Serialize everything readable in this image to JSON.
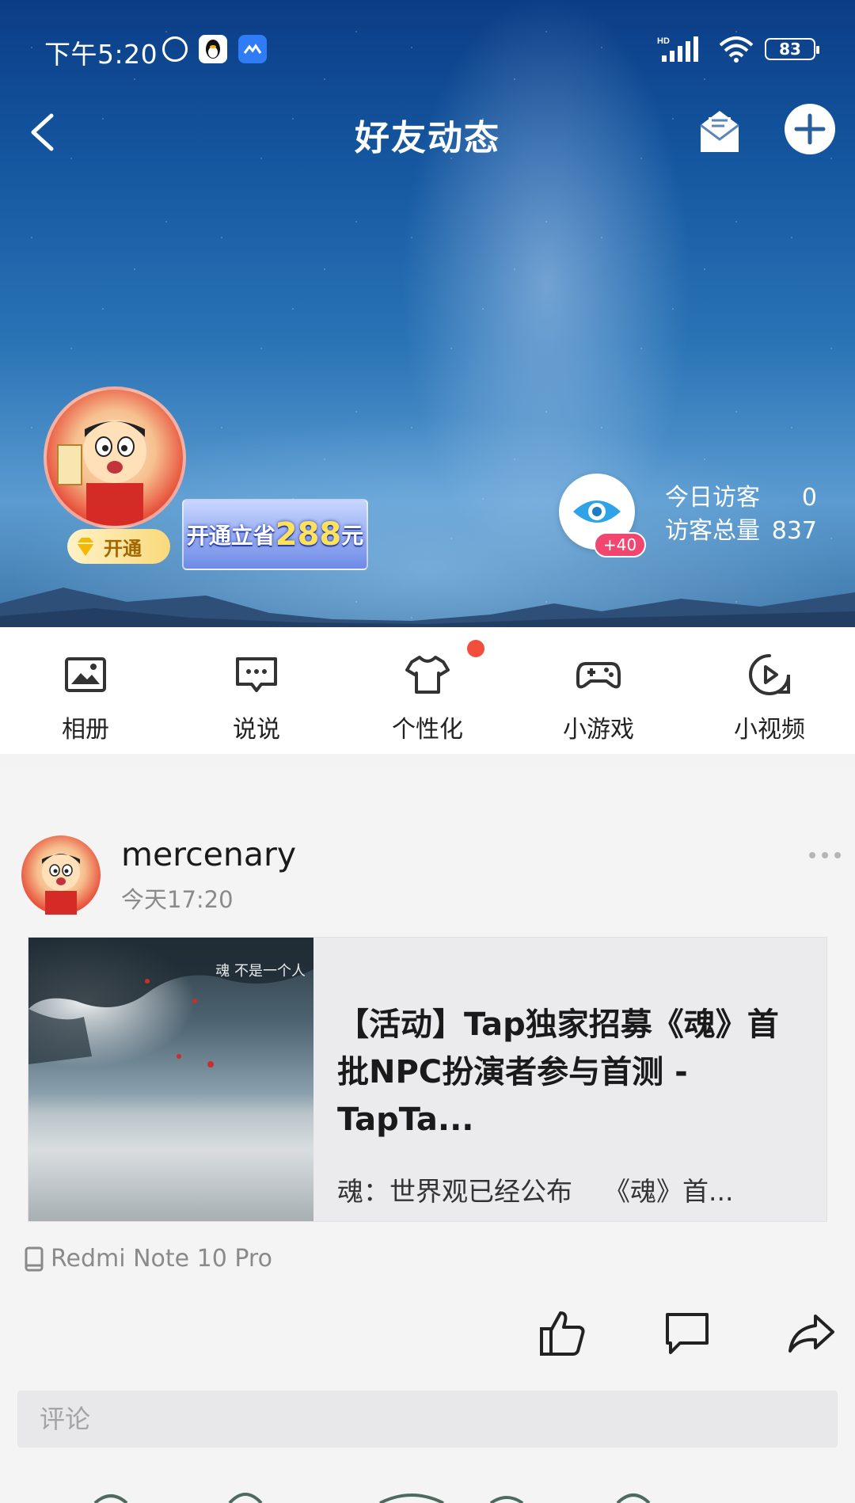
{
  "status_bar": {
    "time": "下午5:20",
    "network": "HD",
    "battery": "83"
  },
  "nav": {
    "title": "好友动态"
  },
  "profile": {
    "vip_label": "开通",
    "promo_text_prefix": "开通立省",
    "promo_amount": "288",
    "promo_suffix": "元",
    "visitor_badge": "+40",
    "today_visitors_label": "今日访客",
    "today_visitors_value": "0",
    "total_visitors_label": "访客总量",
    "total_visitors_value": "837"
  },
  "tabs": [
    {
      "label": "相册",
      "icon": "photo-album-icon"
    },
    {
      "label": "说说",
      "icon": "message-bubble-icon"
    },
    {
      "label": "个性化",
      "icon": "tshirt-icon"
    },
    {
      "label": "小游戏",
      "icon": "gamepad-icon"
    },
    {
      "label": "小视频",
      "icon": "video-play-icon"
    }
  ],
  "post": {
    "author": "mercenary",
    "time": "今天17:20",
    "card": {
      "thumb_caption": "魂 不是一个人",
      "title": "【活动】Tap独家招募《魂》首批NPC扮演者参与首测 - TapTa...",
      "desc_left": "魂：世界观已经公布",
      "desc_right": "《魂》首..."
    },
    "device": "Redmi Note 10 Pro",
    "comment_placeholder": "评论"
  }
}
